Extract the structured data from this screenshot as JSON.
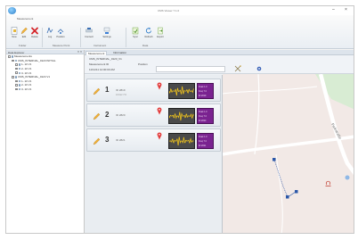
{
  "window": {
    "title": "CMS Viewer 7.1.0",
    "minimize": "–",
    "close": "×"
  },
  "ribbon": {
    "tab": "Measurement",
    "buttons": [
      {
        "label": "New",
        "icon": "new-file-icon"
      },
      {
        "label": "Edit",
        "icon": "edit-icon"
      },
      {
        "label": "Delete",
        "icon": "delete-icon"
      },
      {
        "label": "Log",
        "icon": "log-icon"
      },
      {
        "label": "Position",
        "icon": "position-icon"
      },
      {
        "label": "Connect",
        "icon": "connect-icon"
      },
      {
        "label": "Settings",
        "icon": "settings-icon"
      },
      {
        "label": "Sync",
        "icon": "sync-icon"
      },
      {
        "label": "Refresh",
        "icon": "refresh-icon"
      },
      {
        "label": "Export",
        "icon": "export-icon"
      }
    ],
    "groups": [
      "Folder",
      "Measure Point",
      "Instrument",
      "Data"
    ]
  },
  "left_panel": {
    "title": "Data Explorer",
    "close": "× ×",
    "tree": [
      {
        "level": 0,
        "text": "Measurements"
      },
      {
        "level": 1,
        "text": "CMS_INTERNAL_0123 INITIAL"
      },
      {
        "level": 2,
        "text": "1- 10 V1"
      },
      {
        "level": 2,
        "text": "2- 10 V1"
      },
      {
        "level": 2,
        "text": "3- 10 V1"
      },
      {
        "level": 1,
        "text": "CMS_INTERNAL_0124 V1"
      },
      {
        "level": 2,
        "text": "1- 10 V1"
      },
      {
        "level": 2,
        "text": "2- 10 V1"
      },
      {
        "level": 2,
        "text": "3- 10 V1"
      }
    ]
  },
  "doc_tabs": [
    "Measurement",
    "Information"
  ],
  "info": {
    "line1": "CMS_INTERNAL_0123_V1",
    "line2_label": "Measurement ID",
    "line2_value": "Position",
    "line3": "11/11/11 12:00:00 AM"
  },
  "devices": [
    {
      "num": "1",
      "info": "ID 2819",
      "sub": "3.0 Hz 7.0",
      "stat1": "Peak 1.0",
      "stat2": "Freq 7.0",
      "stat3": "ID 2819"
    },
    {
      "num": "2",
      "info": "ID 2820",
      "sub": "",
      "stat1": "Peak 1.0",
      "stat2": "Freq 7.0",
      "stat3": "ID 2820"
    },
    {
      "num": "3",
      "info": "ID 2821",
      "sub": "",
      "stat1": "Peak 1.0",
      "stat2": "Freq 7.0",
      "stat3": "ID 2821"
    }
  ],
  "map": {
    "street_label": "Parkstraße",
    "colors": {
      "road": "#ffffff",
      "land": "#f2e9e6",
      "park": "#d8ecd3",
      "marker": "#2b57a8",
      "pin": "#e23b3b"
    }
  }
}
